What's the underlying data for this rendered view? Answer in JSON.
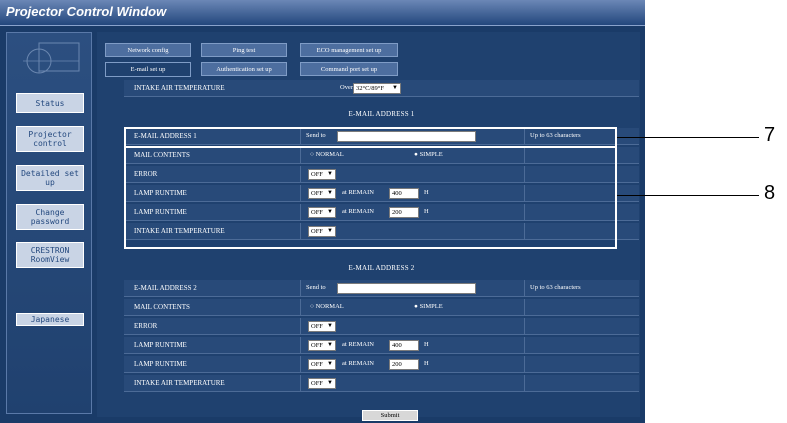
{
  "window": {
    "title": "Projector Control Window"
  },
  "sidebar": {
    "items": [
      {
        "label": "Status"
      },
      {
        "label": "Projector control"
      },
      {
        "label": "Detailed set up"
      },
      {
        "label": "Change password"
      },
      {
        "label": "CRESTRON RoomView"
      },
      {
        "label": "Japanese"
      }
    ]
  },
  "tabs": {
    "row1": [
      "Network config",
      "Ping test",
      "ECO management set up"
    ],
    "row2": [
      "E-mail set up",
      "Authentication set up",
      "Command port set up"
    ]
  },
  "top_row": {
    "label": "INTAKE AIR TEMPERATURE",
    "over_text": "Over",
    "temp_value": "32°C/89°F"
  },
  "email1": {
    "section_title": "E-MAIL ADDRESS 1",
    "address_label": "E-MAIL ADDRESS 1",
    "send_to": "Send to",
    "address_value": "",
    "note": "Up to 63 characters",
    "contents_label": "MAIL CONTENTS",
    "normal": "NORMAL",
    "simple": "SIMPLE",
    "error_label": "ERROR",
    "error_value": "OFF",
    "lamp1_label": "LAMP RUNTIME",
    "lamp1_value": "OFF",
    "at_remain": "at REMAIN",
    "lamp1_hours": "400",
    "h": "H",
    "lamp2_label": "LAMP RUNTIME",
    "lamp2_value": "OFF",
    "lamp2_hours": "200",
    "intake_label": "INTAKE AIR TEMPERATURE",
    "intake_value": "OFF"
  },
  "email2": {
    "section_title": "E-MAIL ADDRESS 2",
    "address_label": "E-MAIL ADDRESS 2",
    "send_to": "Send to",
    "address_value": "",
    "note": "Up to 63 characters",
    "contents_label": "MAIL CONTENTS",
    "normal": "NORMAL",
    "simple": "SIMPLE",
    "error_label": "ERROR",
    "error_value": "OFF",
    "lamp1_label": "LAMP RUNTIME",
    "lamp1_value": "OFF",
    "at_remain": "at REMAIN",
    "lamp1_hours": "400",
    "h": "H",
    "lamp2_label": "LAMP RUNTIME",
    "lamp2_value": "OFF",
    "lamp2_hours": "200",
    "intake_label": "INTAKE AIR TEMPERATURE",
    "intake_value": "OFF"
  },
  "submit_label": "Submit",
  "callouts": {
    "a": "7",
    "b": "8"
  },
  "colors": {
    "frame": "#1a3b68",
    "button": "#c9d4e5",
    "accent": "#23487e"
  }
}
